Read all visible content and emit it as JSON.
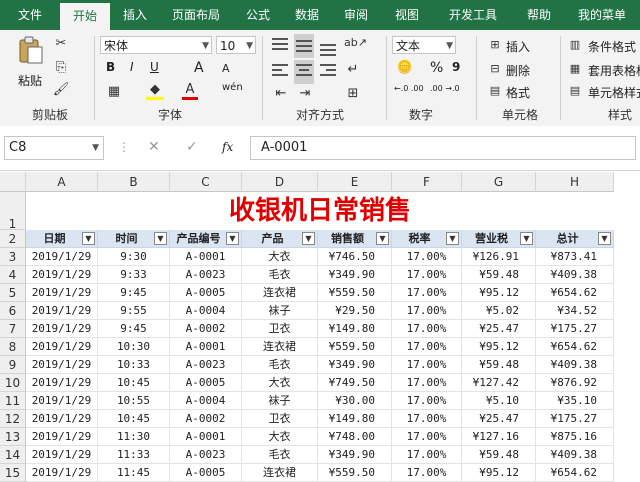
{
  "ribbon_tabs": [
    "文件",
    "开始",
    "插入",
    "页面布局",
    "公式",
    "数据",
    "审阅",
    "视图",
    "开发工具",
    "帮助",
    "我的菜单"
  ],
  "active_tab": "开始",
  "clipboard": {
    "paste_label": "粘贴",
    "group_label": "剪贴板"
  },
  "font": {
    "name": "宋体",
    "size": "10",
    "group_label": "字体",
    "bold": "B",
    "italic": "I",
    "underline": "U",
    "grow": "A",
    "shrink": "A",
    "wen": "wén"
  },
  "alignment": {
    "group_label": "对齐方式"
  },
  "number": {
    "format": "文本",
    "group_label": "数字",
    "percent": "%",
    "comma": "9",
    "inc_dec": "←.0 .00",
    "dec_dec": ".00 →.0"
  },
  "cells_group": {
    "insert": "插入",
    "delete": "删除",
    "format": "格式",
    "group_label": "单元格"
  },
  "styles_group": {
    "conditional": "条件格式",
    "table": "套用表格格",
    "cell_styles": "单元格样式",
    "group_label": "样式"
  },
  "formula_bar": {
    "name_box": "C8",
    "fx": "fx",
    "value": "A-0001"
  },
  "columns": [
    "A",
    "B",
    "C",
    "D",
    "E",
    "F",
    "G",
    "H"
  ],
  "sheet": {
    "title": "收银机日常销售",
    "headers": [
      "日期",
      "时间",
      "产品编号",
      "产品",
      "销售额",
      "税率",
      "营业税",
      "总计"
    ],
    "rows": [
      [
        "2019/1/29",
        "9:30",
        "A-0001",
        "大衣",
        "¥746.50",
        "17.00%",
        "¥126.91",
        "¥873.41"
      ],
      [
        "2019/1/29",
        "9:33",
        "A-0023",
        "毛衣",
        "¥349.90",
        "17.00%",
        "¥59.48",
        "¥409.38"
      ],
      [
        "2019/1/29",
        "9:45",
        "A-0005",
        "连衣裙",
        "¥559.50",
        "17.00%",
        "¥95.12",
        "¥654.62"
      ],
      [
        "2019/1/29",
        "9:55",
        "A-0004",
        "袜子",
        "¥29.50",
        "17.00%",
        "¥5.02",
        "¥34.52"
      ],
      [
        "2019/1/29",
        "9:45",
        "A-0002",
        "卫衣",
        "¥149.80",
        "17.00%",
        "¥25.47",
        "¥175.27"
      ],
      [
        "2019/1/29",
        "10:30",
        "A-0001",
        "连衣裙",
        "¥559.50",
        "17.00%",
        "¥95.12",
        "¥654.62"
      ],
      [
        "2019/1/29",
        "10:33",
        "A-0023",
        "毛衣",
        "¥349.90",
        "17.00%",
        "¥59.48",
        "¥409.38"
      ],
      [
        "2019/1/29",
        "10:45",
        "A-0005",
        "大衣",
        "¥749.50",
        "17.00%",
        "¥127.42",
        "¥876.92"
      ],
      [
        "2019/1/29",
        "10:55",
        "A-0004",
        "袜子",
        "¥30.00",
        "17.00%",
        "¥5.10",
        "¥35.10"
      ],
      [
        "2019/1/29",
        "10:45",
        "A-0002",
        "卫衣",
        "¥149.80",
        "17.00%",
        "¥25.47",
        "¥175.27"
      ],
      [
        "2019/1/29",
        "11:30",
        "A-0001",
        "大衣",
        "¥748.00",
        "17.00%",
        "¥127.16",
        "¥875.16"
      ],
      [
        "2019/1/29",
        "11:33",
        "A-0023",
        "毛衣",
        "¥349.90",
        "17.00%",
        "¥59.48",
        "¥409.38"
      ],
      [
        "2019/1/29",
        "11:45",
        "A-0005",
        "连衣裙",
        "¥559.50",
        "17.00%",
        "¥95.12",
        "¥654.62"
      ]
    ],
    "row_numbers": [
      "1",
      "2",
      "3",
      "4",
      "5",
      "6",
      "7",
      "8",
      "9",
      "10",
      "11",
      "12",
      "13",
      "14",
      "15"
    ]
  }
}
